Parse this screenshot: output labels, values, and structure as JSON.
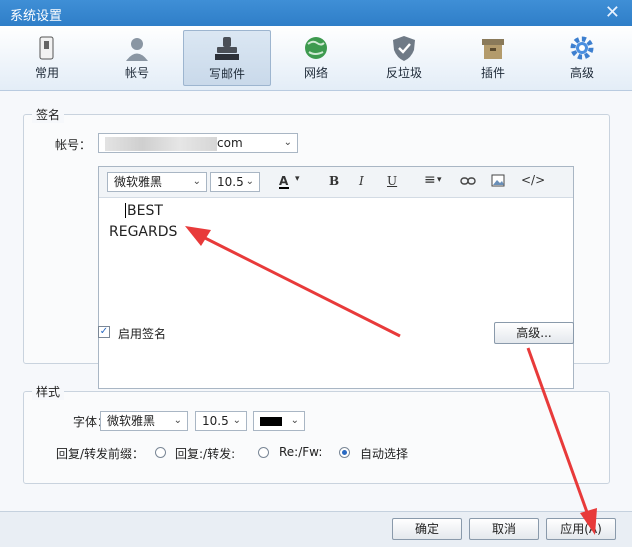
{
  "window": {
    "title": "系统设置",
    "close_glyph": "✕"
  },
  "tabs": [
    {
      "label": "常用",
      "icon": "phone-icon"
    },
    {
      "label": "帐号",
      "icon": "user-icon"
    },
    {
      "label": "写邮件",
      "icon": "stamp-icon",
      "active": true
    },
    {
      "label": "网络",
      "icon": "globe-icon"
    },
    {
      "label": "反垃圾",
      "icon": "shield-icon"
    },
    {
      "label": "插件",
      "icon": "box-icon"
    },
    {
      "label": "高级",
      "icon": "gear-icon"
    }
  ],
  "signature": {
    "group_label": "签名",
    "account_label": "帐号：",
    "account_value": "com",
    "font_name": "微软雅黑",
    "font_size": "10.5",
    "body_line1": "BEST",
    "body_line2": "REGARDS",
    "enable_label": "启用签名",
    "advanced_button": "高级..."
  },
  "style": {
    "group_label": "样式",
    "font_label": "字体：",
    "font_name": "微软雅黑",
    "font_size": "10.5",
    "prefix_label": "回复/转发前缀：",
    "options": [
      "回复:/转发:",
      "Re:/Fw:",
      "自动选择"
    ],
    "selected": "自动选择"
  },
  "footer": {
    "ok": "确定",
    "cancel": "取消",
    "apply": "应用(A)"
  },
  "colors": {
    "accent": "#2f7ec8",
    "arrow": "#e83a3a"
  }
}
